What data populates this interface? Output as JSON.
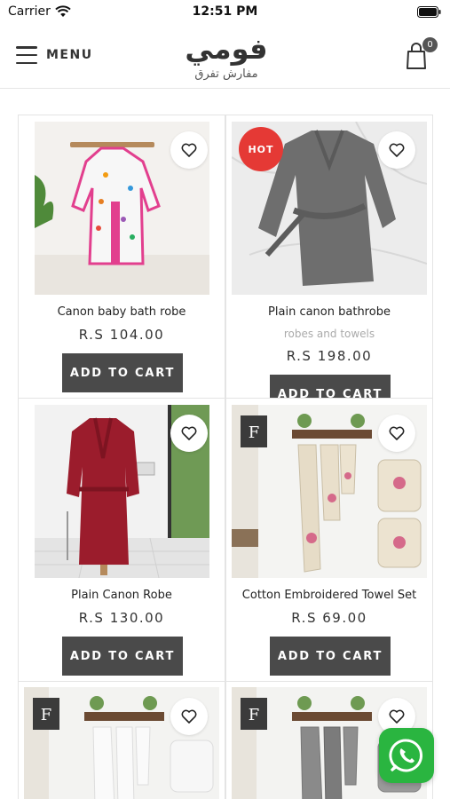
{
  "status_bar": {
    "carrier": "Carrier",
    "time": "12:51 PM"
  },
  "header": {
    "menu_label": "MENU",
    "logo_text": "فومي",
    "logo_subtitle": "مفارش تفرق",
    "cart_count": "0"
  },
  "products": [
    {
      "title": "Canon baby bath robe",
      "price": "R.S 104.00",
      "button": "ADD TO CART",
      "image": "kids-robe-on-hook"
    },
    {
      "title": "Plain canon bathrobe",
      "category": "robes and towels",
      "price": "R.S 198.00",
      "button": "ADD TO CART",
      "badge": "HOT",
      "image": "grey-robe-on-marble"
    },
    {
      "title": "Plain Canon Robe",
      "price": "R.S 130.00",
      "button": "ADD TO CART",
      "image": "red-robe-on-stand"
    },
    {
      "title": "Cotton Embroidered Towel Set",
      "price": "R.S 69.00",
      "button": "ADD TO CART",
      "image": "embroidered-towels-on-rack"
    },
    {
      "image": "white-towels-on-rack"
    },
    {
      "image": "grey-towels-on-rack"
    }
  ],
  "icons": {
    "menu": "hamburger-icon",
    "cart": "shopping-bag-icon",
    "wishlist": "heart-outline-icon",
    "chat": "whatsapp-icon"
  },
  "colors": {
    "button_bg": "#4a4a4a",
    "hot_badge": "#e53935",
    "whatsapp": "#2ab540",
    "cart_badge": "#555555"
  }
}
